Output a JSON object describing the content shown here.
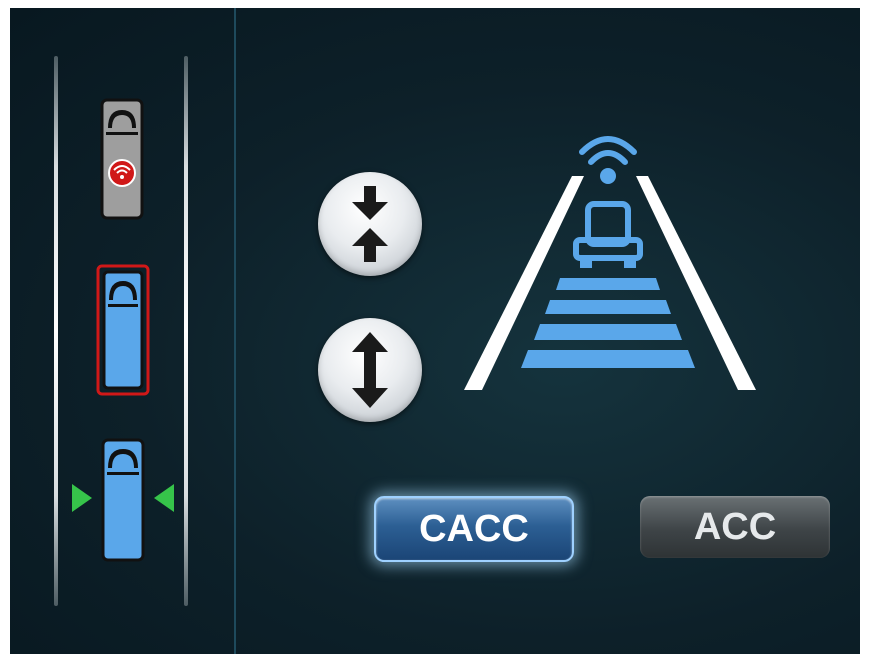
{
  "platoon_panel": {
    "vehicles": [
      {
        "role": "lead-truck",
        "color": "#9e9e9e",
        "badge_icon": "wifi-badge-icon"
      },
      {
        "role": "ego-truck",
        "color": "#5aa7ea",
        "highlight": "#d01818"
      },
      {
        "role": "following-truck",
        "color": "#5aa7ea",
        "indicator_color": "#36c44a"
      }
    ]
  },
  "controls": {
    "gap_decrease_icon": "arrows-converge-icon",
    "gap_increase_icon": "arrows-diverge-icon"
  },
  "modes": {
    "cacc_label": "CACC",
    "acc_label": "ACC",
    "active": "CACC"
  },
  "colors": {
    "accent_blue": "#5aa7ea",
    "warning_red": "#d01818",
    "indicator_green": "#36c44a",
    "background": "#0d2029"
  }
}
